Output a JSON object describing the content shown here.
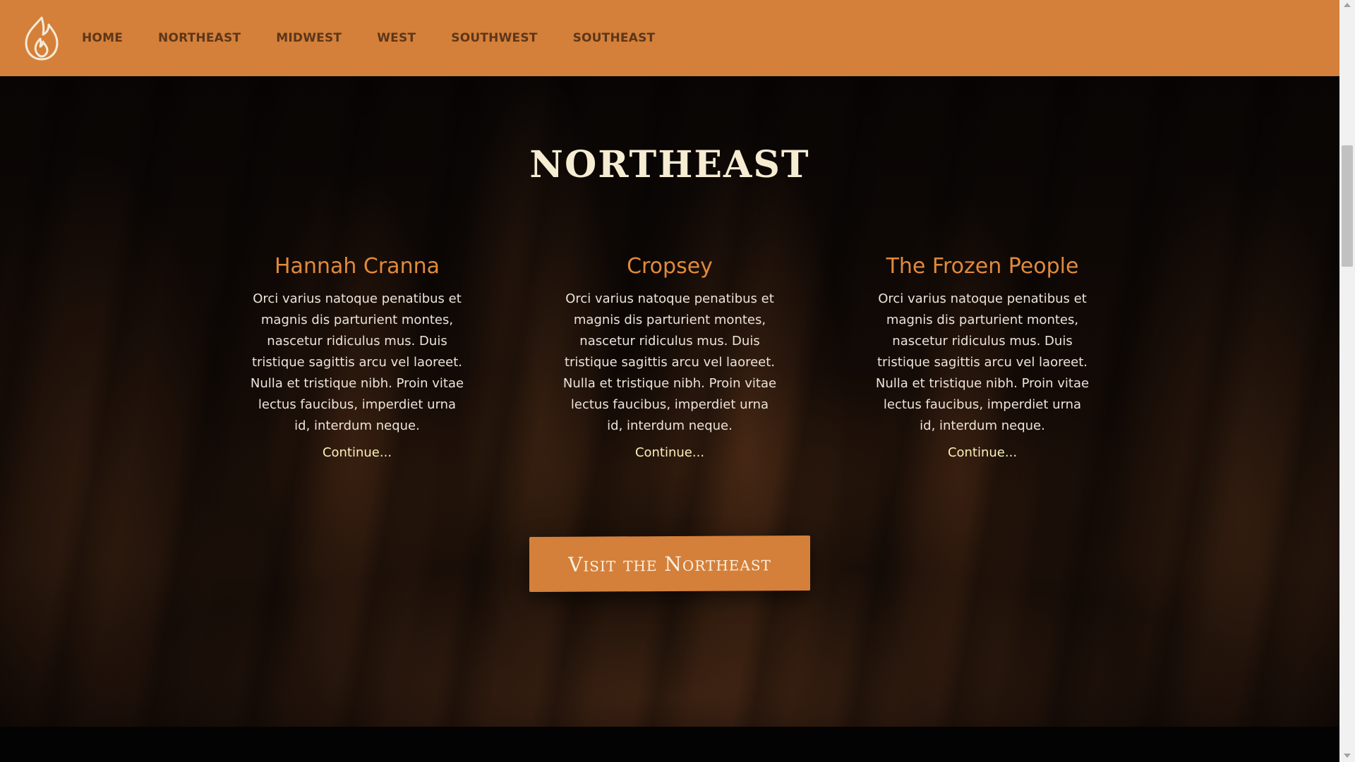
{
  "nav": {
    "logo_icon": "flame-icon",
    "links": [
      "HOME",
      "NORTHEAST",
      "MIDWEST",
      "WEST",
      "SOUTHWEST",
      "SOUTHEAST"
    ]
  },
  "section": {
    "title": "NORTHEAST"
  },
  "cards": [
    {
      "title": "Hannah Cranna",
      "body": "Orci varius natoque penatibus et magnis dis parturient montes, nascetur ridiculus mus. Duis tristique sagittis arcu vel laoreet. Nulla et tristique nibh. Proin vitae lectus faucibus, imperdiet urna id, interdum neque.",
      "link": "Continue..."
    },
    {
      "title": "Cropsey",
      "body": "Orci varius natoque penatibus et magnis dis parturient montes, nascetur ridiculus mus. Duis tristique sagittis arcu vel laoreet. Nulla et tristique nibh. Proin vitae lectus faucibus, imperdiet urna id, interdum neque.",
      "link": "Continue..."
    },
    {
      "title": "The Frozen People",
      "body": "Orci varius natoque penatibus et magnis dis parturient montes, nascetur ridiculus mus. Duis tristique sagittis arcu vel laoreet. Nulla et tristique nibh. Proin vitae lectus faucibus, imperdiet urna id, interdum neque.",
      "link": "Continue..."
    }
  ],
  "cta": {
    "label": "Visit the Northeast"
  },
  "colors": {
    "accent": "#d4803a",
    "nav_text": "#5d3619",
    "card_title": "#e08a3c",
    "link": "#fbf0b9"
  }
}
